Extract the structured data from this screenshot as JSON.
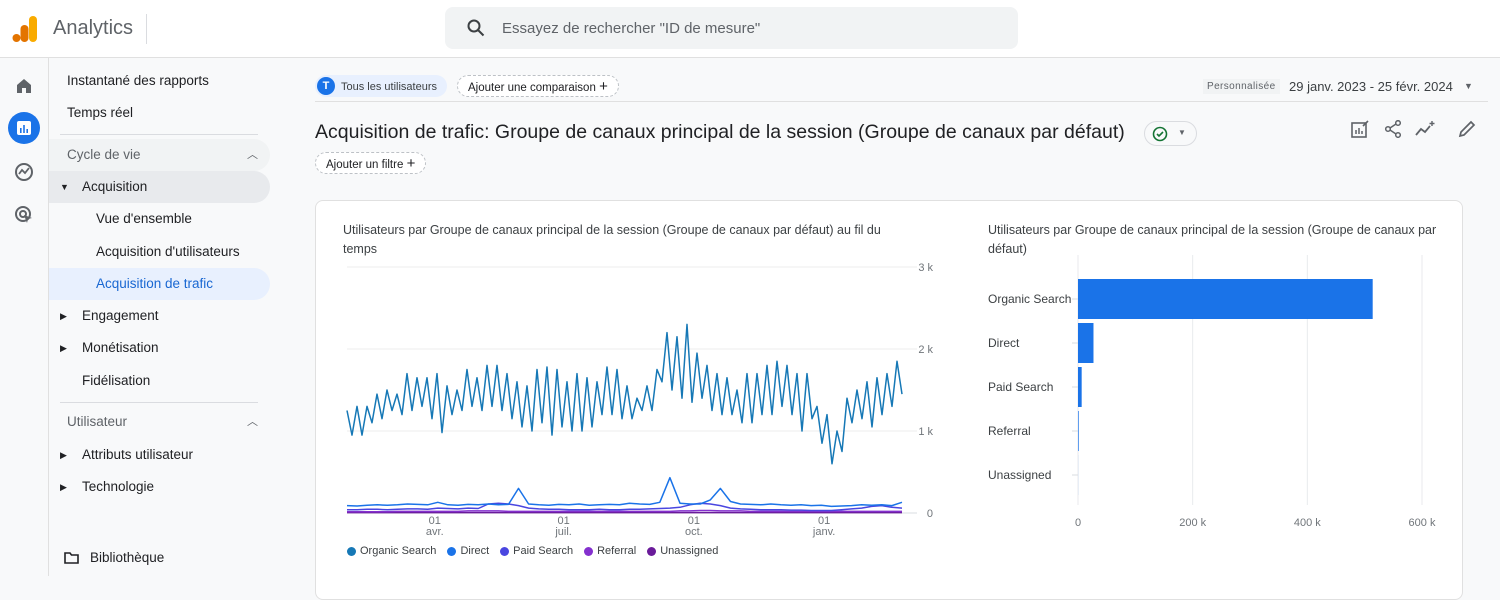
{
  "app": {
    "name": "Analytics",
    "search_placeholder": "Essayez de rechercher \"ID de mesure\""
  },
  "nav": {
    "snapshot": "Instantané des rapports",
    "realtime": "Temps réel",
    "lifecycle": "Cycle de vie",
    "acquisition": "Acquisition",
    "overview": "Vue d'ensemble",
    "user_acq": "Acquisition d'utilisateurs",
    "traffic_acq": "Acquisition de trafic",
    "engagement": "Engagement",
    "monetization": "Monétisation",
    "retention": "Fidélisation",
    "user": "Utilisateur",
    "user_attributes": "Attributs utilisateur",
    "tech": "Technologie",
    "library": "Bibliothèque"
  },
  "header": {
    "segment_initial": "T",
    "segment": "Tous les utilisateurs",
    "add_comparison": "Ajouter une comparaison",
    "date_badge": "Personnalisée",
    "date_range": "29 janv. 2023 - 25 févr. 2024",
    "title": "Acquisition de trafic: Groupe de canaux principal de la session (Groupe de canaux par défaut)",
    "add_filter": "Ajouter un filtre"
  },
  "colors": {
    "accent": "#1a73e8",
    "organic": "#1678b6",
    "direct": "#1a73e8",
    "paid": "#4a46e0",
    "referral": "#8430ce",
    "unassigned": "#6a1b9a"
  },
  "chart_data": [
    {
      "type": "line",
      "title": "Utilisateurs par Groupe de canaux principal de la session (Groupe de canaux par défaut) au fil du temps",
      "x_range": [
        "2023-01-29",
        "2024-02-25"
      ],
      "x_ticks": [
        {
          "day": "01",
          "month": "avr.",
          "date": "2023-04-01"
        },
        {
          "day": "01",
          "month": "juil.",
          "date": "2023-07-01"
        },
        {
          "day": "01",
          "month": "oct.",
          "date": "2023-10-01"
        },
        {
          "day": "01",
          "month": "janv.",
          "date": "2024-01-01"
        }
      ],
      "y_ticks": [
        "0",
        "1 k",
        "2 k",
        "3 k"
      ],
      "ylim": [
        0,
        3000
      ],
      "grid": true,
      "legend": "bottom",
      "series": [
        {
          "name": "Organic Search",
          "values": [
            1250,
            950,
            1300,
            950,
            1300,
            1100,
            1450,
            1150,
            1500,
            1250,
            1450,
            1200,
            1700,
            1250,
            1650,
            1300,
            1650,
            1150,
            1700,
            980,
            1550,
            1200,
            1500,
            1250,
            1750,
            1300,
            1650,
            1250,
            1800,
            1300,
            1800,
            1250,
            1700,
            1150,
            1600,
            1050,
            1550,
            1000,
            1750,
            1100,
            1780,
            950,
            1750,
            1050,
            1600,
            1000,
            1700,
            1000,
            1650,
            1050,
            1600,
            1200,
            1780,
            1200,
            1750,
            1150,
            1550,
            1150,
            1400,
            1250,
            1550,
            1250,
            1750,
            1600,
            2200,
            1500,
            2150,
            1400,
            2300,
            1350,
            1950,
            1400,
            1800,
            1250,
            1700,
            1200,
            1650,
            1200,
            1500,
            1100,
            1700,
            1100,
            1700,
            1200,
            1800,
            1200,
            1850,
            1300,
            1800,
            1200,
            1700,
            1000,
            1700,
            1150,
            1300,
            850,
            1200,
            600,
            1000,
            750,
            1400,
            1100,
            1500,
            1150,
            1600,
            1050,
            1650,
            1200,
            1700,
            1300,
            1850,
            1450
          ]
        },
        {
          "name": "Direct",
          "values": [
            90,
            85,
            95,
            100,
            95,
            100,
            110,
            105,
            100,
            130,
            100,
            95,
            105,
            100,
            110,
            100,
            105,
            300,
            110,
            100,
            95,
            105,
            100,
            110,
            95,
            100,
            105,
            100,
            120,
            110,
            105,
            130,
            430,
            120,
            110,
            110,
            160,
            300,
            140,
            110,
            105,
            100,
            110,
            100,
            95,
            100,
            90,
            95,
            80,
            85,
            90,
            100,
            95,
            100,
            90,
            130
          ]
        },
        {
          "name": "Paid Search",
          "values": [
            40,
            40,
            45,
            45,
            40,
            45,
            50,
            50,
            45,
            60,
            55,
            50,
            60,
            55,
            110,
            120,
            110,
            90,
            60,
            50,
            45,
            45,
            40,
            40,
            40,
            45,
            40,
            40,
            45,
            45,
            50,
            55,
            60,
            70,
            100,
            120,
            110,
            90,
            60,
            50,
            45,
            40,
            40,
            40,
            35,
            35,
            30,
            30,
            30,
            40,
            50,
            60,
            80,
            90,
            70,
            60
          ]
        },
        {
          "name": "Referral",
          "values": [
            15,
            15,
            15,
            15,
            15,
            20,
            20,
            20,
            20,
            20,
            20,
            20,
            25,
            25,
            25,
            25,
            20,
            20,
            20,
            20,
            20,
            20,
            20,
            20,
            20,
            20,
            20,
            20,
            20,
            20,
            20,
            20,
            20,
            25,
            25,
            30,
            30,
            25,
            25,
            25,
            20,
            20,
            20,
            20,
            20,
            20,
            20,
            20,
            20,
            20,
            20,
            20,
            20,
            20,
            20,
            20
          ]
        },
        {
          "name": "Unassigned",
          "values": [
            5,
            5,
            5,
            5,
            5,
            5,
            5,
            5,
            5,
            5,
            5,
            5,
            5,
            5,
            5,
            5,
            5,
            5,
            5,
            5,
            5,
            5,
            5,
            5,
            5,
            5,
            5,
            5,
            5,
            5,
            5,
            5,
            5,
            5,
            5,
            5,
            5,
            5,
            5,
            5,
            5,
            5,
            5,
            5,
            5,
            5,
            5,
            5,
            5,
            5,
            5,
            5,
            5,
            5,
            5,
            5
          ]
        }
      ]
    },
    {
      "type": "bar",
      "orientation": "horizontal",
      "title": "Utilisateurs par Groupe de canaux principal de la session (Groupe de canaux par défaut)",
      "categories": [
        "Organic Search",
        "Direct",
        "Paid Search",
        "Referral",
        "Unassigned"
      ],
      "values": [
        514000,
        27000,
        6400,
        1200,
        100
      ],
      "x_ticks": [
        "0",
        "200 k",
        "400 k",
        "600 k"
      ],
      "xlim": [
        0,
        600000
      ],
      "grid": true
    }
  ]
}
